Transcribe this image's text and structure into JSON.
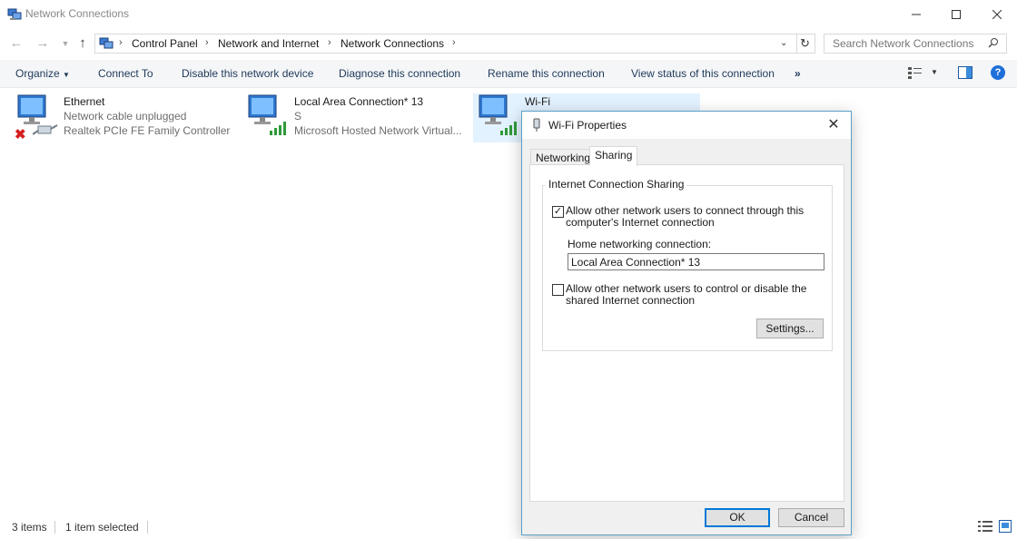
{
  "window": {
    "title": "Network Connections"
  },
  "address": {
    "crumbs": [
      "Control Panel",
      "Network and Internet",
      "Network Connections"
    ]
  },
  "search": {
    "placeholder": "Search Network Connections"
  },
  "commands": [
    "Organize",
    "Connect To",
    "Disable this network device",
    "Diagnose this connection",
    "Rename this connection",
    "View status of this connection"
  ],
  "items": [
    {
      "name": "Ethernet",
      "line1": "Network cable unplugged",
      "line2": "Realtek PCIe FE Family Controller"
    },
    {
      "name": "Local Area Connection* 13",
      "line1": "S",
      "line2": "Microsoft Hosted Network Virtual..."
    },
    {
      "name": "Wi-Fi"
    }
  ],
  "status": {
    "count": "3 items",
    "selected": "1 item selected"
  },
  "dialog": {
    "title": "Wi-Fi Properties",
    "tabs": [
      "Networking",
      "Sharing"
    ],
    "group_title": "Internet Connection Sharing",
    "allow_connect_line1": "Allow other network users to connect through this",
    "allow_connect_line2": "computer's Internet connection",
    "allow_connect_checked": true,
    "home_label": "Home networking connection:",
    "home_value": "Local Area Connection* 13",
    "allow_control_line1": "Allow other network users to control or disable the",
    "allow_control_line2": "shared Internet connection",
    "allow_control_checked": false,
    "settings_label": "Settings...",
    "ok_label": "OK",
    "cancel_label": "Cancel"
  },
  "colors": {
    "accent": "#0078d7",
    "signal": "#2e9a3a",
    "error": "#d61f1f"
  }
}
